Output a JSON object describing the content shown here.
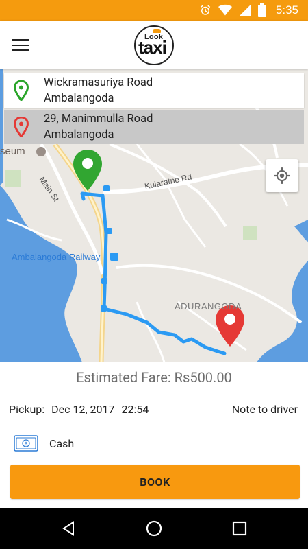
{
  "status_bar": {
    "time": "5:35",
    "color": "#f59b0e"
  },
  "app_bar": {
    "logo_top": "Look",
    "logo_main": "taxi"
  },
  "pickup": {
    "line1": "Wickramasuriya Road",
    "line2": "Ambalangoda",
    "icon": "green-pin-icon",
    "color": "#2aa52a"
  },
  "dropoff": {
    "line1": "29, Manimmulla Road",
    "line2": "Ambalangoda",
    "icon": "red-pin-icon",
    "color": "#e53935"
  },
  "map": {
    "labels": {
      "museum": "seum",
      "main_st": "Main St",
      "kularatne": "Kularatne Rd",
      "railway": "Ambalangoda Railway",
      "adurangoda": "ADURANGODA"
    },
    "route_color": "#2b9af3"
  },
  "fare": {
    "text": "Estimated Fare: Rs500.00"
  },
  "pickup_time": {
    "label": "Pickup:",
    "date": "Dec 12, 2017",
    "time": "22:54"
  },
  "note_link": "Note to driver",
  "payment": {
    "label": "Cash",
    "icon": "cash-icon"
  },
  "book_button": {
    "label": "BOOK",
    "color": "#f8990f"
  }
}
